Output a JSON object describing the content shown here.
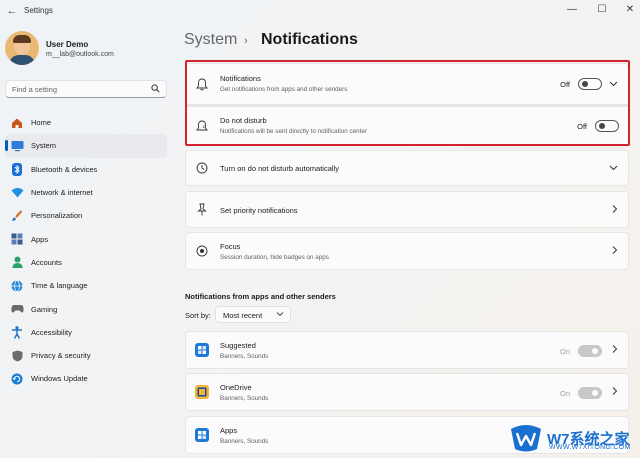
{
  "window": {
    "title": "Settings",
    "controls": {
      "minimize": "—",
      "maximize": "☐",
      "close": "✕"
    }
  },
  "profile": {
    "name": "User Demo",
    "email": "m__lab@outlook.com"
  },
  "search": {
    "placeholder": "Find a setting"
  },
  "sidebar": {
    "items": [
      {
        "label": "Home",
        "icon": "home-icon",
        "color": "#c9541a"
      },
      {
        "label": "System",
        "icon": "system-icon",
        "color": "#2c7dd6",
        "active": true
      },
      {
        "label": "Bluetooth & devices",
        "icon": "bluetooth-icon",
        "color": "#1b6fd6"
      },
      {
        "label": "Network & internet",
        "icon": "network-icon",
        "color": "#1e90e0"
      },
      {
        "label": "Personalization",
        "icon": "brush-icon",
        "color": "#d46b2a"
      },
      {
        "label": "Apps",
        "icon": "apps-icon",
        "color": "#3a5b8f"
      },
      {
        "label": "Accounts",
        "icon": "accounts-icon",
        "color": "#2aa16a"
      },
      {
        "label": "Time & language",
        "icon": "globe-icon",
        "color": "#2a86d6"
      },
      {
        "label": "Gaming",
        "icon": "gaming-icon",
        "color": "#6a6a6a"
      },
      {
        "label": "Accessibility",
        "icon": "accessibility-icon",
        "color": "#1f6fc2"
      },
      {
        "label": "Privacy & security",
        "icon": "shield-icon",
        "color": "#6b6b6b"
      },
      {
        "label": "Windows Update",
        "icon": "update-icon",
        "color": "#1a7fd4"
      }
    ]
  },
  "header": {
    "parent": "System",
    "separator": "›",
    "current": "Notifications"
  },
  "settings": {
    "notifications": {
      "title": "Notifications",
      "subtitle": "Get notifications from apps and other senders",
      "state": "Off"
    },
    "dnd": {
      "title": "Do not disturb",
      "subtitle": "Notifications will be sent directly to notification center",
      "state": "Off"
    },
    "auto_dnd": {
      "title": "Turn on do not disturb automatically"
    },
    "priority": {
      "title": "Set priority notifications"
    },
    "focus": {
      "title": "Focus",
      "subtitle": "Session duration, hide badges on apps"
    }
  },
  "senders": {
    "section_title": "Notifications from apps and other senders",
    "sort_label": "Sort by:",
    "sort_value": "Most recent",
    "apps": [
      {
        "name": "Suggested",
        "details": "Banners, Sounds",
        "state": "On",
        "icon_color": "#1f7ad6"
      },
      {
        "name": "OneDrive",
        "details": "Banners, Sounds",
        "state": "On",
        "icon_color": "#f2b233"
      },
      {
        "name": "Apps",
        "details": "Banners, Sounds",
        "icon_color": "#1f7ad6"
      }
    ]
  },
  "watermark": {
    "text": "W7系统之家",
    "url": "WWW.W7XITONG.COM"
  }
}
